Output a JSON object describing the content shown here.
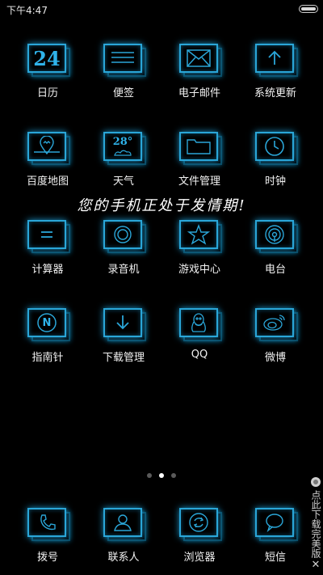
{
  "status_bar": {
    "time": "下午4:47",
    "battery_icon": "battery-icon"
  },
  "apps": [
    {
      "id": "calendar",
      "label": "日历",
      "icon": "calendar-icon",
      "icon_text": "24"
    },
    {
      "id": "notes",
      "label": "便签",
      "icon": "notes-icon"
    },
    {
      "id": "email",
      "label": "电子邮件",
      "icon": "mail-icon"
    },
    {
      "id": "updater",
      "label": "系统更新",
      "icon": "update-arrow-icon"
    },
    {
      "id": "baidu-map",
      "label": "百度地图",
      "icon": "map-pin-icon"
    },
    {
      "id": "weather",
      "label": "天气",
      "icon": "weather-icon",
      "icon_text": "28°"
    },
    {
      "id": "file-manager",
      "label": "文件管理",
      "icon": "folder-icon"
    },
    {
      "id": "clock",
      "label": "时钟",
      "icon": "clock-icon"
    },
    {
      "id": "calculator",
      "label": "计算器",
      "icon": "calculator-icon"
    },
    {
      "id": "recorder",
      "label": "录音机",
      "icon": "record-icon"
    },
    {
      "id": "game-center",
      "label": "游戏中心",
      "icon": "star-icon"
    },
    {
      "id": "radio",
      "label": "电台",
      "icon": "radio-icon"
    },
    {
      "id": "compass",
      "label": "指南针",
      "icon": "compass-icon",
      "icon_text": "N"
    },
    {
      "id": "downloads",
      "label": "下载管理",
      "icon": "download-icon"
    },
    {
      "id": "qq",
      "label": "QQ",
      "icon": "qq-penguin-icon"
    },
    {
      "id": "weibo",
      "label": "微博",
      "icon": "weibo-icon"
    }
  ],
  "banner_text": "您的手机正处于发情期!",
  "pager": {
    "pages": 3,
    "active": 2
  },
  "dock": [
    {
      "id": "phone",
      "label": "拨号",
      "icon": "phone-icon"
    },
    {
      "id": "contacts",
      "label": "联系人",
      "icon": "contacts-icon"
    },
    {
      "id": "browser",
      "label": "浏览器",
      "icon": "browser-icon"
    },
    {
      "id": "sms",
      "label": "短信",
      "icon": "message-icon"
    }
  ],
  "ad": {
    "text": "点此下载完美版",
    "close": "✕"
  },
  "colors": {
    "icon_glow": "#2aa6d8",
    "background": "#000000"
  }
}
